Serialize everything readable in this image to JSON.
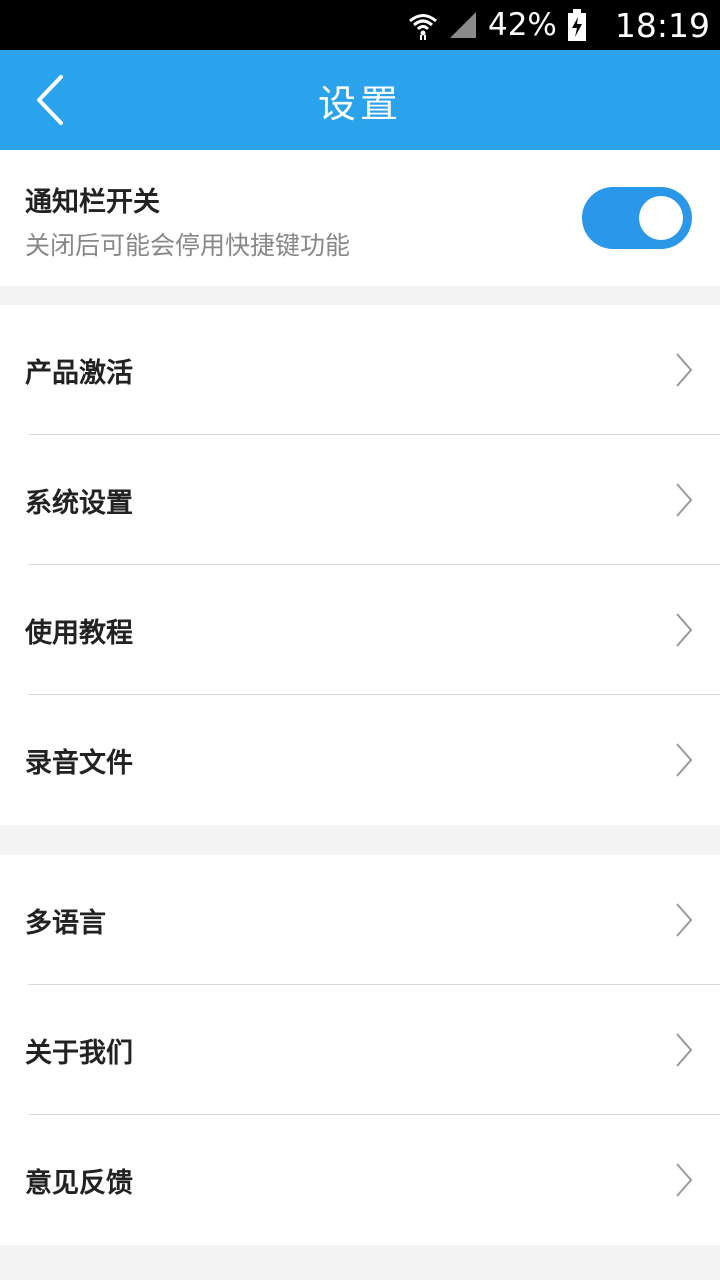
{
  "status_bar": {
    "battery": "42%",
    "time": "18:19",
    "icons": [
      "wifi-icon",
      "signal-icon",
      "battery-charging-icon"
    ]
  },
  "header": {
    "title": "设置",
    "back_icon": "chevron-left-icon"
  },
  "notification": {
    "title": "通知栏开关",
    "subtitle": "关闭后可能会停用快捷键功能",
    "toggle_on": true
  },
  "group1": [
    {
      "label": "产品激活"
    },
    {
      "label": "系统设置"
    },
    {
      "label": "使用教程"
    },
    {
      "label": "录音文件"
    }
  ],
  "group2": [
    {
      "label": "多语言"
    },
    {
      "label": "关于我们"
    },
    {
      "label": "意见反馈"
    }
  ],
  "colors": {
    "accent": "#2aa3ec",
    "toggle_on": "#2a97e8",
    "chevron": "#9a9a9a"
  }
}
